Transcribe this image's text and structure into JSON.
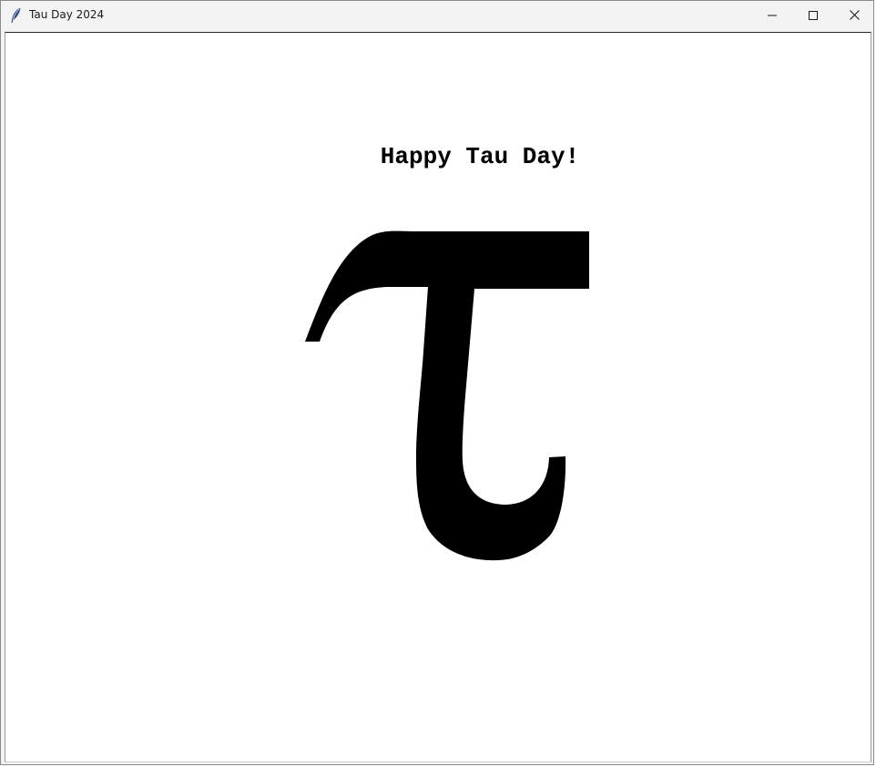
{
  "window": {
    "title": "Tau Day 2024"
  },
  "icons": {
    "app": "feather-icon",
    "minimize": "minimize-icon",
    "maximize": "maximize-icon",
    "close": "close-icon"
  },
  "canvas": {
    "greeting": "Happy Tau Day!",
    "symbol": "tau-symbol"
  },
  "colors": {
    "titlebar": "#f3f3f3",
    "canvas_background": "#ffffff",
    "ink": "#000000"
  }
}
